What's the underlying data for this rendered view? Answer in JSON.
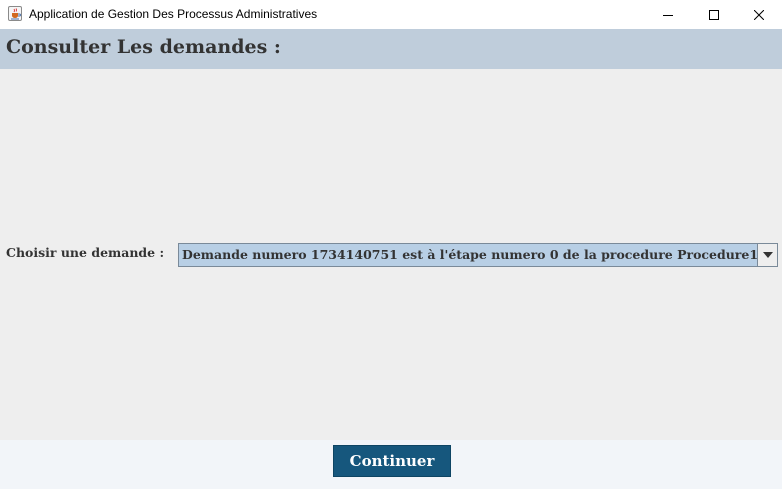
{
  "window": {
    "title": "Application de Gestion Des Processus Administratives",
    "app_icon": "java-coffee-icon",
    "controls": [
      "minimize-icon",
      "maximize-icon",
      "close-icon"
    ]
  },
  "header": {
    "title": "Consulter Les demandes :"
  },
  "form": {
    "choose_label": "Choisir une demande :",
    "selected_demande": "Demande numero 1734140751 est à l'étape numero 0 de la procedure Procedure1"
  },
  "footer": {
    "continue_label": "Continuer"
  },
  "colors": {
    "header_bg": "#bfcddb",
    "combo_bg": "#b8cfe5",
    "button_bg": "#16577d"
  }
}
